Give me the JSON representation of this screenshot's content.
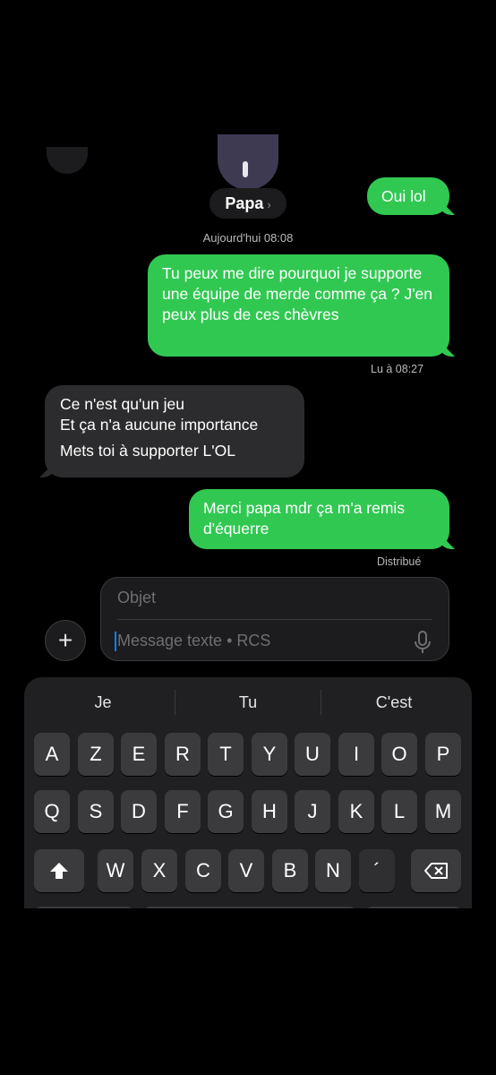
{
  "header": {
    "contact_name": "Papa",
    "chevron": "›"
  },
  "conversation": {
    "timestamp": "Aujourd'hui 08:08",
    "messages": [
      {
        "id": "m0",
        "direction": "out",
        "text": "Oui lol"
      },
      {
        "id": "m1",
        "direction": "out",
        "text": "Tu peux me dire pourquoi je supporte une équipe de merde comme ça ? J'en peux plus de ces chèvres",
        "status": "Lu à 08:27"
      },
      {
        "id": "m2",
        "direction": "in",
        "line1": "Ce n'est qu'un jeu",
        "line2": "Et ça n'a aucune importance",
        "line3": "Mets toi à supporter L'OL"
      },
      {
        "id": "m3",
        "direction": "out",
        "text": "Merci papa mdr ça m'a remis d'équerre",
        "status": "Distribué"
      }
    ]
  },
  "compose": {
    "subject_placeholder": "Objet",
    "message_placeholder": "Message texte • RCS",
    "add_button": "+"
  },
  "keyboard": {
    "suggestions": [
      "Je",
      "Tu",
      "C'est"
    ],
    "row1": [
      "A",
      "Z",
      "E",
      "R",
      "T",
      "Y",
      "U",
      "I",
      "O",
      "P"
    ],
    "row2": [
      "Q",
      "S",
      "D",
      "F",
      "G",
      "H",
      "J",
      "K",
      "L",
      "M"
    ],
    "row3": [
      "W",
      "X",
      "C",
      "V",
      "B",
      "N",
      "´"
    ]
  },
  "colors": {
    "outgoing": "#31c852",
    "incoming": "#2c2c2e",
    "background": "#000000",
    "cursor": "#0a84ff"
  }
}
